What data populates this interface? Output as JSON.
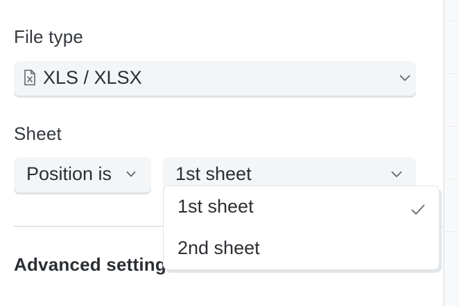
{
  "file_type": {
    "label": "File type",
    "value": "XLS / XLSX",
    "icon": "excel-file-icon"
  },
  "sheet": {
    "label": "Sheet",
    "condition": "Position is",
    "value": "1st sheet",
    "options": [
      {
        "label": "1st sheet",
        "selected": true
      },
      {
        "label": "2nd sheet",
        "selected": false
      }
    ]
  },
  "advanced": {
    "label": "Advanced settings"
  },
  "colors": {
    "select_bg": "#f3f5f7",
    "text": "#2b2f33",
    "check": "#6a7077"
  }
}
